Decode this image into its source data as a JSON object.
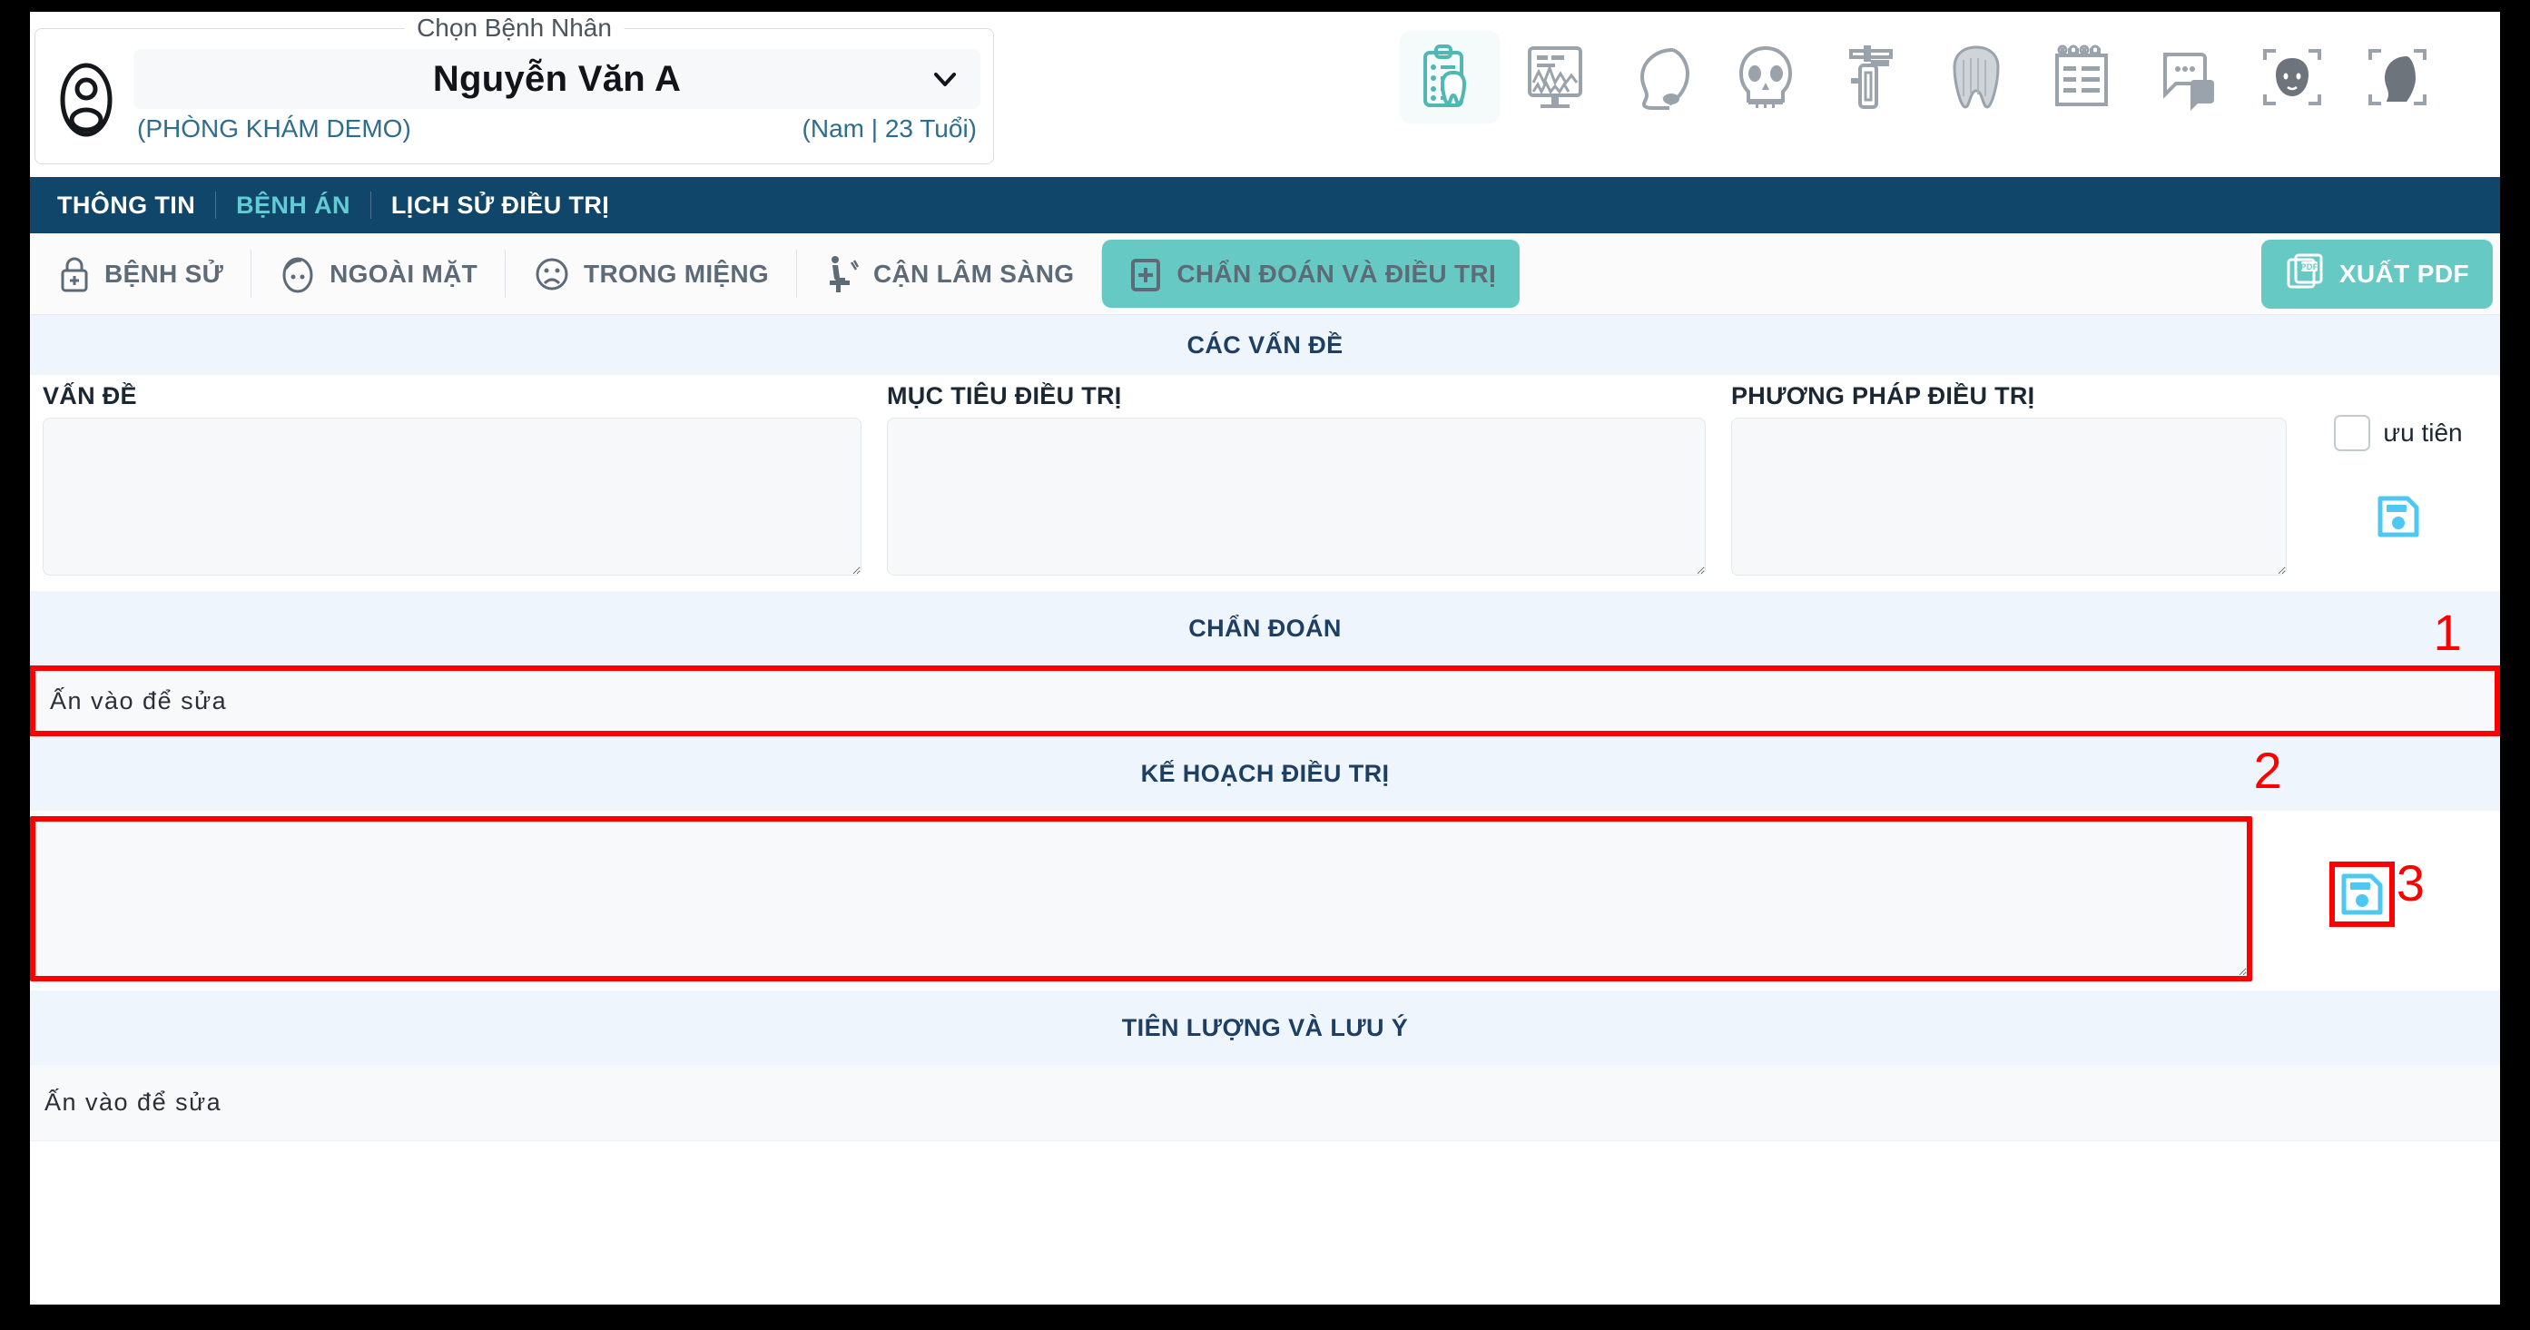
{
  "patient": {
    "legend": "Chọn Bệnh Nhân",
    "name": "Nguyễn Văn A",
    "clinic": "(PHÒNG KHÁM DEMO)",
    "demographics": "(Nam | 23 Tuổi)",
    "avatar_icon": "user-circle-icon",
    "chevron_icon": "chevron-down-icon"
  },
  "toolbar": {
    "icons": [
      {
        "name": "clipboard-tooth-icon",
        "active": true
      },
      {
        "name": "xray-monitor-icon",
        "active": false
      },
      {
        "name": "head-profile-icon",
        "active": false
      },
      {
        "name": "skull-icon",
        "active": false
      },
      {
        "name": "caliper-icon",
        "active": false
      },
      {
        "name": "tooth-icon",
        "active": false
      },
      {
        "name": "notebook-icon",
        "active": false
      },
      {
        "name": "chat-bubble-icon",
        "active": false
      },
      {
        "name": "face-scan-icon",
        "active": false
      },
      {
        "name": "profile-scan-icon",
        "active": false
      }
    ]
  },
  "nav": {
    "items": [
      {
        "label": "THÔNG TIN",
        "active": false
      },
      {
        "label": "BỆNH ÁN",
        "active": true
      },
      {
        "label": "LỊCH SỬ ĐIỀU TRỊ",
        "active": false
      }
    ]
  },
  "tabs": [
    {
      "label": "BỆNH SỬ",
      "icon": "lock-plus-icon",
      "active": false
    },
    {
      "label": "NGOÀI MẶT",
      "icon": "face-outline-icon",
      "active": false
    },
    {
      "label": "TRONG MIỆNG",
      "icon": "sad-face-icon",
      "active": false
    },
    {
      "label": "CẬN LÂM SÀNG",
      "icon": "dental-chair-icon",
      "active": false
    },
    {
      "label": "CHẨN ĐOÁN VÀ ĐIỀU TRỊ",
      "icon": "plus-square-icon",
      "active": true
    }
  ],
  "export": {
    "label": "XUẤT PDF",
    "icon": "pdf-pages-icon",
    "badge": "PDF"
  },
  "sections": {
    "problems": {
      "title": "CÁC VẤN ĐỀ",
      "columns": [
        {
          "label": "VẤN ĐỀ",
          "value": "",
          "name": "problem-textarea"
        },
        {
          "label": "MỤC TIÊU ĐIỀU TRỊ",
          "value": "",
          "name": "treatment-goal-textarea"
        },
        {
          "label": "PHƯƠNG PHÁP ĐIỀU TRỊ",
          "value": "",
          "name": "treatment-method-textarea"
        }
      ],
      "priority_label": "ưu tiên",
      "priority_checked": false,
      "save_icon": "save-floppy-icon"
    },
    "diagnosis": {
      "title": "CHẨN ĐOÁN",
      "placeholder": "Ấn vào để sửa",
      "value": ""
    },
    "plan": {
      "title": "KẾ HOẠCH ĐIỀU TRỊ",
      "value": "",
      "save_icon": "save-floppy-icon"
    },
    "prognosis": {
      "title": "TIÊN LƯỢNG VÀ LƯU Ý",
      "placeholder": "Ấn vào để sửa",
      "value": ""
    }
  },
  "annotations": [
    {
      "number": "1",
      "target": "diagnosis-row"
    },
    {
      "number": "2",
      "target": "plan-textarea"
    },
    {
      "number": "3",
      "target": "plan-save-button"
    }
  ],
  "colors": {
    "navbar": "#11466b",
    "accent_teal": "#66c9c4",
    "nav_active": "#63ccd2",
    "section_header_bg": "#eff5fd",
    "section_header_text": "#1c3f63",
    "annotation_red": "#fe0000",
    "save_icon_cyan": "#4ec8f0"
  }
}
